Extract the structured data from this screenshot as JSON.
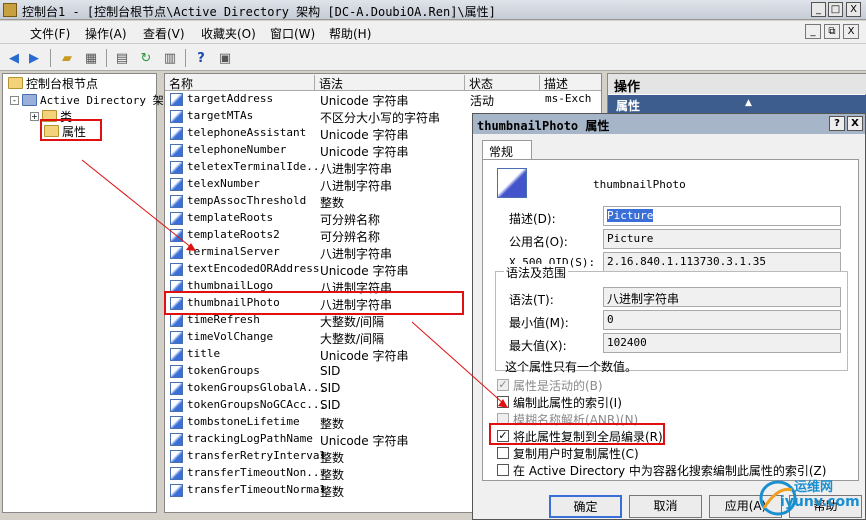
{
  "window": {
    "title": "控制台1 - [控制台根节点\\Active Directory 架构 [DC-A.DoubiOA.Ren]\\属性]",
    "min": "_",
    "max": "□",
    "close": "X"
  },
  "menu": [
    "文件(F)",
    "操作(A)",
    "查看(V)",
    "收藏夹(O)",
    "窗口(W)",
    "帮助(H)"
  ],
  "mdi_buttons": [
    "_",
    "⧉",
    "X"
  ],
  "tree": {
    "root": "控制台根节点",
    "node": "Active Directory 架",
    "expander": "-",
    "child_expander": "+",
    "classes": "类",
    "attributes": "属性"
  },
  "list": {
    "headers": [
      "名称",
      "语法",
      "状态",
      "描述"
    ],
    "rows": [
      {
        "name": "targetAddress",
        "syntax": "Unicode 字符串",
        "status": "活动",
        "desc": "ms-Exch"
      },
      {
        "name": "targetMTAs",
        "syntax": "不区分大小写的字符串",
        "status": "",
        "desc": ""
      },
      {
        "name": "telephoneAssistant",
        "syntax": "Unicode 字符串",
        "status": "",
        "desc": ""
      },
      {
        "name": "telephoneNumber",
        "syntax": "Unicode 字符串",
        "status": "",
        "desc": ""
      },
      {
        "name": "teletexTerminalIde...",
        "syntax": "八进制字符串",
        "status": "",
        "desc": ""
      },
      {
        "name": "telexNumber",
        "syntax": "八进制字符串",
        "status": "",
        "desc": ""
      },
      {
        "name": "tempAssocThreshold",
        "syntax": "整数",
        "status": "",
        "desc": ""
      },
      {
        "name": "templateRoots",
        "syntax": "可分辨名称",
        "status": "",
        "desc": ""
      },
      {
        "name": "templateRoots2",
        "syntax": "可分辨名称",
        "status": "",
        "desc": ""
      },
      {
        "name": "terminalServer",
        "syntax": "八进制字符串",
        "status": "",
        "desc": ""
      },
      {
        "name": "textEncodedORAddress",
        "syntax": "Unicode 字符串",
        "status": "",
        "desc": ""
      },
      {
        "name": "thumbnailLogo",
        "syntax": "八进制字符串",
        "status": "",
        "desc": ""
      },
      {
        "name": "thumbnailPhoto",
        "syntax": "八进制字符串",
        "status": "",
        "desc": ""
      },
      {
        "name": "timeRefresh",
        "syntax": "大整数/间隔",
        "status": "",
        "desc": ""
      },
      {
        "name": "timeVolChange",
        "syntax": "大整数/间隔",
        "status": "",
        "desc": ""
      },
      {
        "name": "title",
        "syntax": "Unicode 字符串",
        "status": "",
        "desc": ""
      },
      {
        "name": "tokenGroups",
        "syntax": "SID",
        "status": "",
        "desc": ""
      },
      {
        "name": "tokenGroupsGlobalA...",
        "syntax": "SID",
        "status": "",
        "desc": ""
      },
      {
        "name": "tokenGroupsNoGCAcc...",
        "syntax": "SID",
        "status": "",
        "desc": ""
      },
      {
        "name": "tombstoneLifetime",
        "syntax": "整数",
        "status": "",
        "desc": ""
      },
      {
        "name": "trackingLogPathName",
        "syntax": "Unicode 字符串",
        "status": "",
        "desc": ""
      },
      {
        "name": "transferRetryInterval",
        "syntax": "整数",
        "status": "",
        "desc": ""
      },
      {
        "name": "transferTimeoutNon...",
        "syntax": "整数",
        "status": "",
        "desc": ""
      },
      {
        "name": "transferTimeoutNormal",
        "syntax": "整数",
        "status": "",
        "desc": ""
      }
    ]
  },
  "actions": {
    "title": "操作",
    "sub": "属性"
  },
  "dialog": {
    "title": "thumbnailPhoto 属性",
    "help": "?",
    "close": "X",
    "tab": "常规",
    "prop_name": "thumbnailPhoto",
    "desc_label": "描述(D):",
    "desc_value": "Picture",
    "common_label": "公用名(O):",
    "common_value": "Picture",
    "oid_label": "X.500 OID(S):",
    "oid_value": "2.16.840.1.113730.3.1.35",
    "group_label": "语法及范围",
    "syntax_label": "语法(T):",
    "syntax_value": "八进制字符串",
    "min_label": "最小值(M):",
    "min_value": "0",
    "max_label": "最大值(X):",
    "max_value": "102400",
    "single_value": "这个属性只有一个数值。",
    "checkboxes": [
      {
        "label": "属性是活动的(B)",
        "mark": "✓"
      },
      {
        "label": "编制此属性的索引(I)",
        "mark": ""
      },
      {
        "label": "模糊名称解析(ANR)(N)",
        "mark": ""
      },
      {
        "label": "将此属性复制到全局编录(R)",
        "mark": "✓"
      },
      {
        "label": "复制用户时复制属性(C)",
        "mark": ""
      },
      {
        "label": "在 Active Directory 中为容器化搜索编制此属性的索引(Z)",
        "mark": ""
      }
    ],
    "ok": "确定",
    "cancel": "取消",
    "apply": "应用(A)",
    "helpbtn": "帮助"
  },
  "watermark": {
    "line1": "运维网",
    "line2": "iyunv.com"
  },
  "colors": {
    "highlight_box": "#e01010",
    "action_header": "#3d5d8f"
  }
}
